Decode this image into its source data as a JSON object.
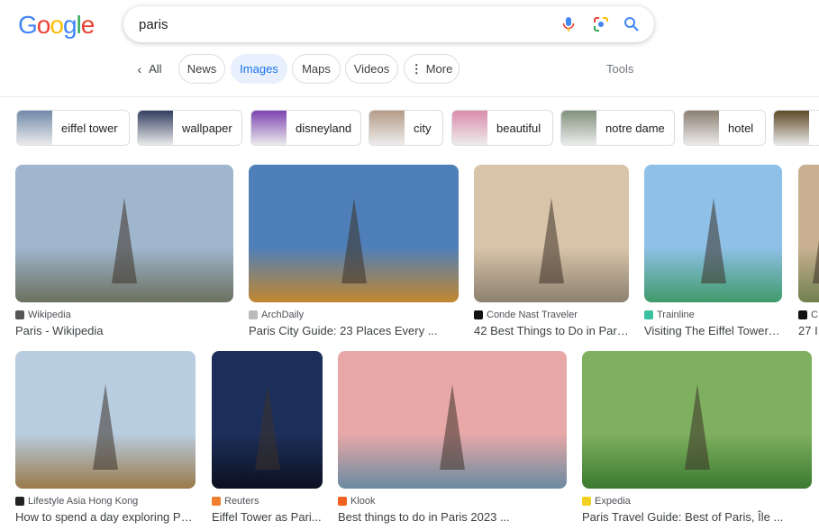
{
  "header": {
    "logo": "Google",
    "query": "paris"
  },
  "tabs": [
    {
      "label": "All",
      "icon": "chevron-left-icon"
    },
    {
      "label": "News"
    },
    {
      "label": "Images",
      "active": true
    },
    {
      "label": "Maps"
    },
    {
      "label": "Videos"
    },
    {
      "label": "More",
      "icon": "more-vert-icon"
    }
  ],
  "tools_label": "Tools",
  "chips": [
    {
      "label": "eiffel tower",
      "color": "#6d87a8"
    },
    {
      "label": "wallpaper",
      "color": "#2e3a5c"
    },
    {
      "label": "disneyland",
      "color": "#7a3fb0"
    },
    {
      "label": "city",
      "color": "#b49a86"
    },
    {
      "label": "beautiful",
      "color": "#d98aa8"
    },
    {
      "label": "notre dame",
      "color": "#7f8f7a"
    },
    {
      "label": "hotel",
      "color": "#8a7d70"
    },
    {
      "label": "",
      "color": "#5a4520"
    }
  ],
  "results": [
    {
      "source": "Wikipedia",
      "title": "Paris - Wikipedia",
      "sky": "#9fb6cc",
      "ground": "#6b7060",
      "fav": "#555"
    },
    {
      "source": "ArchDaily",
      "title": "Paris City Guide: 23 Places Every ...",
      "sky": "#4f7fb8",
      "ground": "#c2872e",
      "fav": "#bbb"
    },
    {
      "source": "Conde Nast Traveler",
      "title": "42 Best Things to Do in Pari...",
      "sky": "#d8c4a8",
      "ground": "#8c8070",
      "fav": "#111"
    },
    {
      "source": "Trainline",
      "title": "Visiting The Eiffel Tower |...",
      "sky": "#8fc0e8",
      "ground": "#3f9a6a",
      "fav": "#38c0a0"
    },
    {
      "source": "C",
      "title": "27 I",
      "sky": "#c8b090",
      "ground": "#708050",
      "fav": "#111"
    },
    {
      "source": "Lifestyle Asia Hong Kong",
      "title": "How to spend a day exploring Paris",
      "sky": "#b8cde0",
      "ground": "#9a7a4a",
      "fav": "#222"
    },
    {
      "source": "Reuters",
      "title": "Eiffel Tower as Pari...",
      "sky": "#1c2f5a",
      "ground": "#0c1020",
      "fav": "#f08030"
    },
    {
      "source": "Klook",
      "title": "Best things to do in Paris 2023 ...",
      "sky": "#e8a8a8",
      "ground": "#6a8aa0",
      "fav": "#f06020"
    },
    {
      "source": "Expedia",
      "title": "Paris Travel Guide: Best of Paris, Île ...",
      "sky": "#7fb060",
      "ground": "#3a7a30",
      "fav": "#f0d020"
    }
  ]
}
